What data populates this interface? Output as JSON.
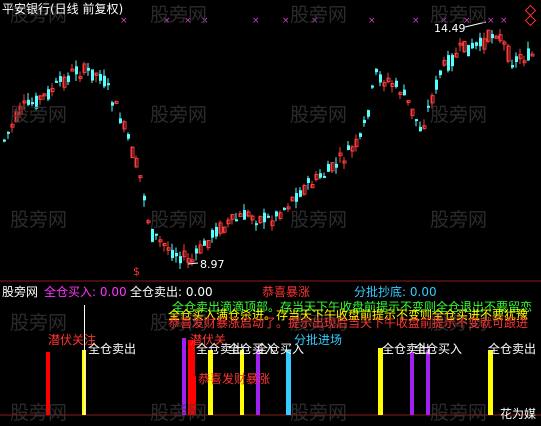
{
  "top_panel": {
    "title": "平安银行(日线 前复权)",
    "high_label": "14.49",
    "low_label": "8.97"
  },
  "indicator_panel": {
    "name": "股旁网",
    "legend": [
      {
        "label": "全仓买入",
        "value": ": 0.00",
        "color": "#ff33ff"
      },
      {
        "label": "全仓卖出",
        "value": ": 0.00",
        "color": "#ffffff"
      },
      {
        "label": "恭喜暴涨",
        "value": "",
        "color": "#ff3333"
      },
      {
        "label": "分批抄底",
        "value": ": 0.00",
        "color": "#33ccff"
      }
    ],
    "messages": [
      {
        "text": "全仓卖出滴滴顶部。存当天下午收盘前提示不变则全仓退出不要留恋",
        "color": "#33ff33"
      },
      {
        "text": "全仓买入满仓杀进。存当天下午收盘前提示不变则全仓买进不要犹豫",
        "color": "#ffff00"
      },
      {
        "text": "恭喜发财暴涨启动了。提示出现后当天下午收盘前提示不变就可跟进",
        "color": "#ff3333"
      }
    ],
    "signals": {
      "qianfu": "潜伏关注",
      "sell": "全仓卖出",
      "buy": "全仓买入",
      "baozhang": "恭喜发财暴涨",
      "fenpi": "分批进场",
      "qianfu2": "潜伏关"
    },
    "corner_text": "花为媒"
  },
  "watermark": "股旁网",
  "colors": {
    "up": "#ff3c3c",
    "down": "#54ffff",
    "sell_bar": "#ffff00",
    "buy_bar": "#a020f0",
    "baozhang_bar": "#ff0000",
    "fenpi_bar": "#33ccff"
  }
}
